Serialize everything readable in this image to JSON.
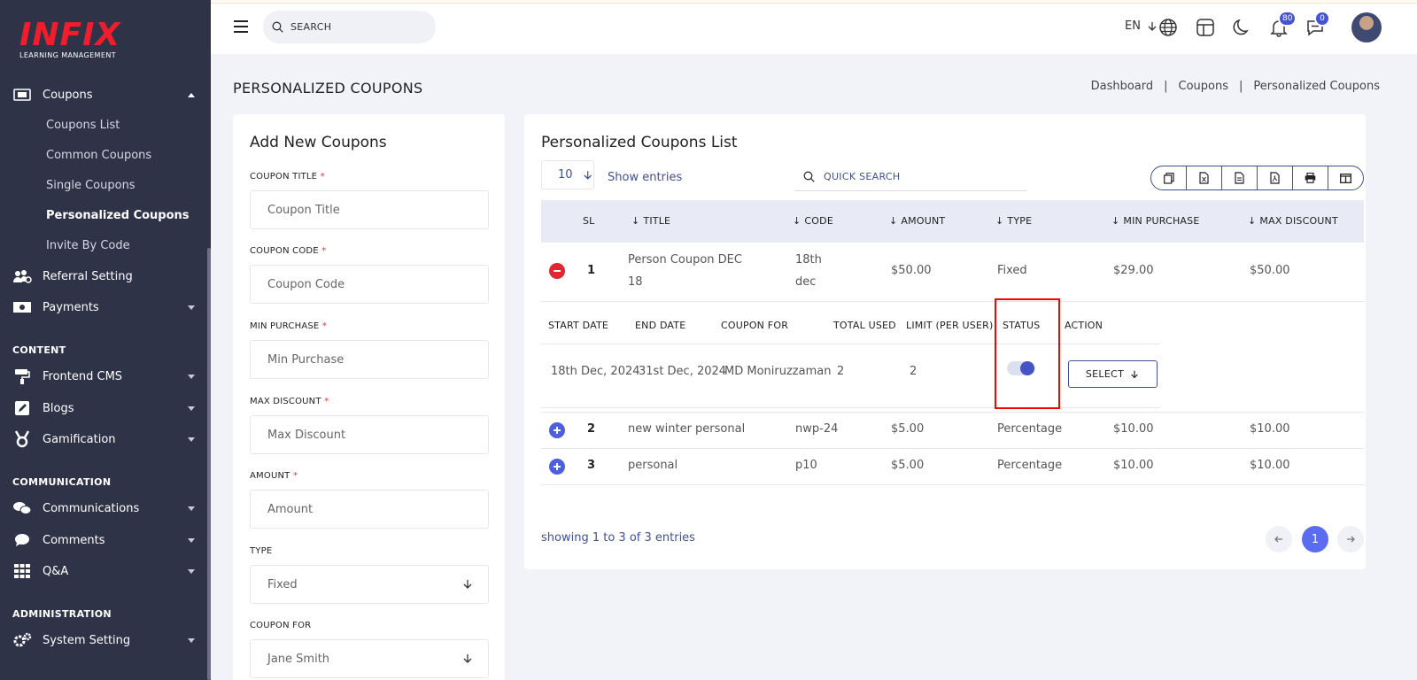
{
  "brand": {
    "logo_main": "INFIX",
    "logo_sub": "LEARNING MANAGEMENT"
  },
  "sidebar": {
    "coupons": {
      "label": "Coupons",
      "subitems": [
        "Coupons List",
        "Common Coupons",
        "Single Coupons",
        "Personalized Coupons",
        "Invite By Code"
      ]
    },
    "referral": "Referral Setting",
    "payments": "Payments",
    "section_content": "CONTENT",
    "frontend_cms": "Frontend CMS",
    "blogs": "Blogs",
    "gamification": "Gamification",
    "section_communication": "COMMUNICATION",
    "communications": "Communications",
    "comments": "Comments",
    "qa": "Q&A",
    "section_administration": "ADMINISTRATION",
    "system_setting": "System Setting"
  },
  "topbar": {
    "search_label": "SEARCH",
    "language": "EN",
    "notifications_count": "80",
    "messages_count": "0"
  },
  "page": {
    "title": "PERSONALIZED COUPONS",
    "breadcrumb": [
      "Dashboard",
      "Coupons",
      "Personalized Coupons"
    ],
    "breadcrumb_sep": "|"
  },
  "form": {
    "title": "Add New Coupons",
    "required_mark": "*",
    "coupon_title": {
      "label": "COUPON TITLE",
      "placeholder": "Coupon Title"
    },
    "coupon_code": {
      "label": "COUPON CODE",
      "placeholder": "Coupon Code"
    },
    "min_purchase": {
      "label": "MIN PURCHASE",
      "placeholder": "Min Purchase"
    },
    "max_discount": {
      "label": "MAX DISCOUNT",
      "placeholder": "Max Discount"
    },
    "amount": {
      "label": "AMOUNT",
      "placeholder": "Amount"
    },
    "type": {
      "label": "TYPE",
      "value": "Fixed"
    },
    "coupon_for": {
      "label": "COUPON FOR",
      "value": "Jane Smith"
    }
  },
  "list": {
    "title": "Personalized Coupons List",
    "entries_value": "10",
    "show_entries": "Show entries",
    "quick_search": "QUICK SEARCH",
    "columns": [
      "SL",
      "TITLE",
      "CODE",
      "AMOUNT",
      "TYPE",
      "MIN PURCHASE",
      "MAX DISCOUNT"
    ],
    "rows": [
      {
        "sl": "1",
        "title_line1": "Person Coupon DEC",
        "title_line2": "18",
        "code_line1": "18th",
        "code_line2": "dec",
        "amount": "$50.00",
        "type": "Fixed",
        "min_purchase": "$29.00",
        "max_discount": "$50.00"
      },
      {
        "sl": "2",
        "title": "new winter personal",
        "code": "nwp-24",
        "amount": "$5.00",
        "type": "Percentage",
        "min_purchase": "$10.00",
        "max_discount": "$10.00"
      },
      {
        "sl": "3",
        "title": "personal",
        "code": "p10",
        "amount": "$5.00",
        "type": "Percentage",
        "min_purchase": "$10.00",
        "max_discount": "$10.00"
      }
    ],
    "detail": {
      "columns": [
        "START DATE",
        "END DATE",
        "COUPON FOR",
        "TOTAL USED",
        "LIMIT (PER USER)",
        "STATUS",
        "ACTION"
      ],
      "start_date": "18th Dec, 2024",
      "end_date": "31st Dec, 2024",
      "coupon_for": "MD Moniruzzaman",
      "total_used": "2",
      "limit": "2",
      "status_on": true,
      "action_label": "SELECT"
    },
    "showing": "showing 1 to 3 of 3 entries",
    "current_page": "1"
  },
  "colors": {
    "sidebar": "#2f3347",
    "accent": "#415094",
    "primary": "#5b6cf0",
    "danger": "#e3262f",
    "highlight": "#ff0000"
  }
}
